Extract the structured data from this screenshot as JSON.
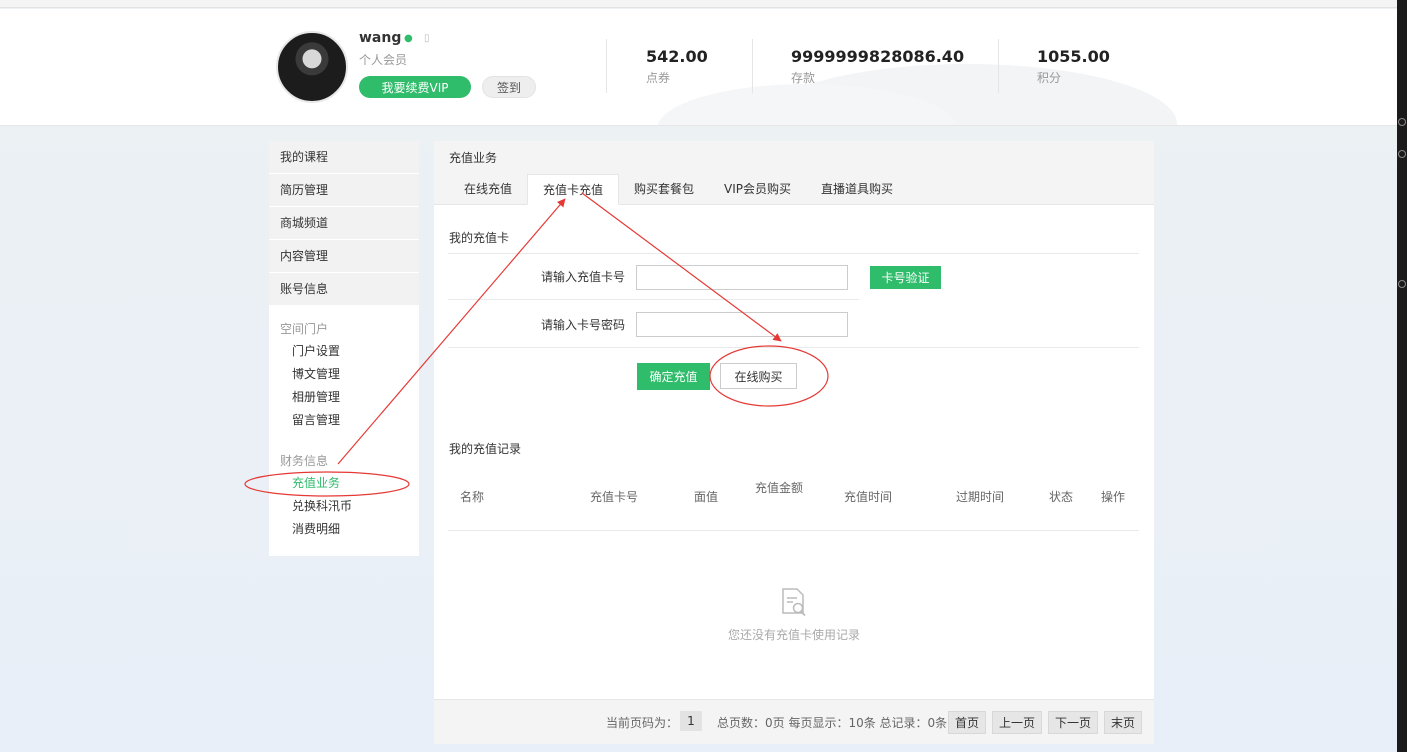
{
  "user": {
    "name": "wang",
    "level": "个人会员",
    "vip_button": "我要续费VIP",
    "sign_button": "签到"
  },
  "stats": [
    {
      "value": "542.00",
      "label": "点券"
    },
    {
      "value": "9999999828086.40",
      "label": "存款"
    },
    {
      "value": "1055.00",
      "label": "积分"
    }
  ],
  "sidebar": {
    "main_items": [
      "我的课程",
      "简历管理",
      "商城频道",
      "内容管理",
      "账号信息"
    ],
    "group_portal": "空间门户",
    "portal_items": [
      "门户设置",
      "博文管理",
      "相册管理",
      "留言管理"
    ],
    "group_finance": "财务信息",
    "finance_items": [
      "充值业务",
      "兑换科汛币",
      "消费明细"
    ],
    "active_item": "充值业务"
  },
  "panel": {
    "title": "充值业务",
    "tabs": [
      "在线充值",
      "充值卡充值",
      "购买套餐包",
      "VIP会员购买",
      "直播道具购买"
    ],
    "active_tab": "充值卡充值"
  },
  "card_form": {
    "section_title": "我的充值卡",
    "card_number_label": "请输入充值卡号",
    "card_number_value": "",
    "card_password_label": "请输入卡号密码",
    "card_password_value": "",
    "verify_button": "卡号验证",
    "confirm_button": "确定充值",
    "buy_online_button": "在线购买"
  },
  "records": {
    "section_title": "我的充值记录",
    "columns": [
      "名称",
      "充值卡号",
      "面值",
      "充值金额",
      "充值时间",
      "过期时间",
      "状态",
      "操作"
    ],
    "rows": [],
    "empty_text": "您还没有充值卡使用记录",
    "empty_icon": "document-search-icon"
  },
  "pager": {
    "current_label": "当前页码为：",
    "current_page": "1",
    "summary": "总页数：0页 每页显示：10条 总记录：0条",
    "first": "首页",
    "prev": "上一页",
    "next": "下一页",
    "last": "末页"
  },
  "colors": {
    "accent": "#2fbc6b",
    "annotation": "#e53935"
  }
}
